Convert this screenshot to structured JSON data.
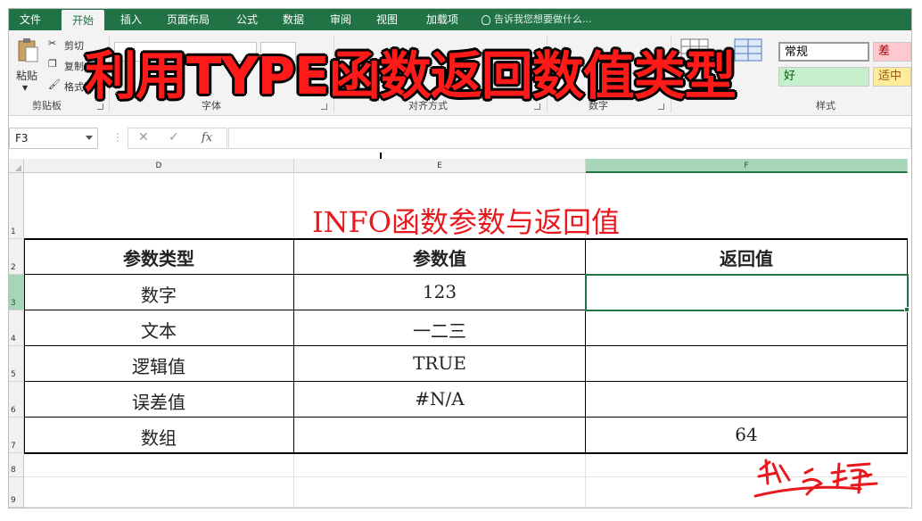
{
  "tabs": [
    "文件",
    "开始",
    "插入",
    "页面布局",
    "公式",
    "数据",
    "审阅",
    "视图",
    "加载项"
  ],
  "active_tab": "开始",
  "tell_me": "告诉我您想要做什么...",
  "ribbon": {
    "clipboard": {
      "paste": "粘贴",
      "cut": "剪切",
      "copy": "复制",
      "format_painter": "格式刷",
      "label": "剪贴板"
    },
    "font": {
      "label": "字体"
    },
    "alignment": {
      "label": "对齐方式"
    },
    "number": {
      "label": "数字"
    },
    "styles": {
      "label": "样式",
      "normal": "常规",
      "bad": "差",
      "good": "好",
      "neutral": "适中"
    }
  },
  "banner": "利用TYPE函数返回数值类型",
  "formula_bar": {
    "name_box": "F3",
    "formula": ""
  },
  "columns": [
    "D",
    "E",
    "F"
  ],
  "selected_column": "F",
  "rows": [
    "1",
    "2",
    "3",
    "4",
    "5",
    "6",
    "7",
    "8",
    "9"
  ],
  "selected_row": "3",
  "sheet": {
    "title": "INFO函数参数与返回值",
    "headers": [
      "参数类型",
      "参数值",
      "返回值"
    ],
    "body": [
      [
        "数字",
        "123",
        ""
      ],
      [
        "文本",
        "一二三",
        ""
      ],
      [
        "逻辑值",
        "TRUE",
        ""
      ],
      [
        "误差值",
        "#N/A",
        ""
      ],
      [
        "数组",
        "",
        "64"
      ]
    ]
  },
  "colors": {
    "excel_green": "#217346",
    "title_red": "#e8191e",
    "banner_red": "#ff1a1a"
  }
}
